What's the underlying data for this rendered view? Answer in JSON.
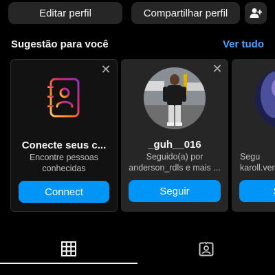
{
  "profile_actions": {
    "edit_label": "Editar perfil",
    "share_label": "Compartilhar perfil",
    "add_user_icon": "add-user-icon"
  },
  "suggestions": {
    "title": "Sugestão para você",
    "see_all": "Ver tudo",
    "cards": [
      {
        "kind": "connect",
        "title": "Conecte seus c...",
        "subtitle_line1": "Encontre pessoas",
        "subtitle_line2": "conhecidas",
        "button": "Connect",
        "icon": "contact-book-icon"
      },
      {
        "kind": "user",
        "title": "_guh__016",
        "subtitle_line1": "Seguido(a) por",
        "subtitle_line2": "anderson_rdls e mais ...",
        "button": "Seguir"
      },
      {
        "kind": "user",
        "title": "",
        "subtitle_line1": "Segu",
        "subtitle_line2": "karoll.ven",
        "button": "S"
      }
    ]
  },
  "tabs": [
    {
      "name": "posts-grid",
      "icon": "grid-icon",
      "active": true
    },
    {
      "name": "tagged",
      "icon": "tagged-person-icon",
      "active": false
    }
  ],
  "colors": {
    "background": "#000000",
    "card": "#262626",
    "accent": "#0095f6",
    "link": "#4aa3ff"
  }
}
